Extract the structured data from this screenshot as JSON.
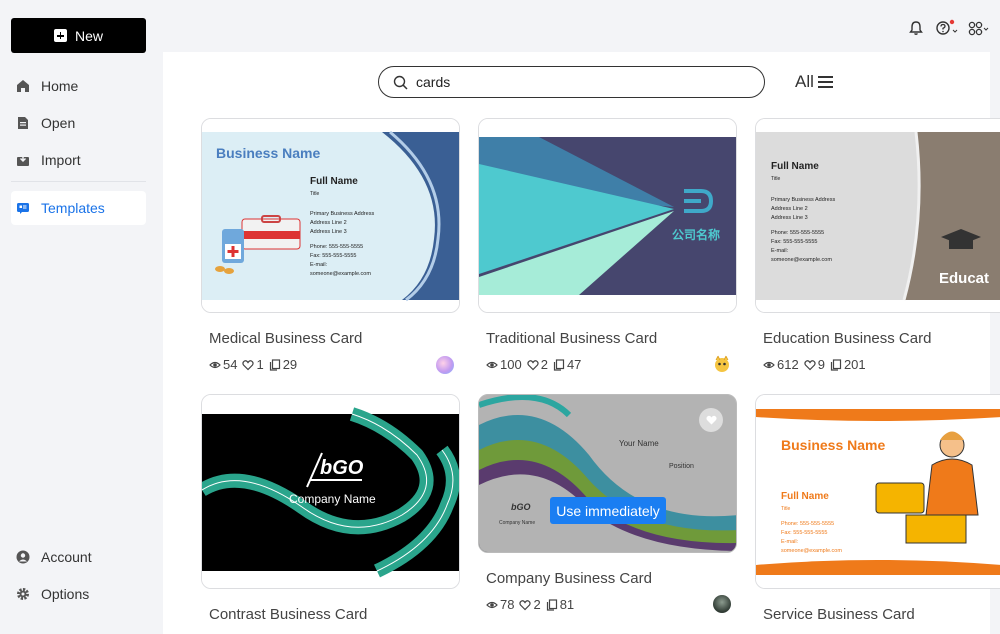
{
  "sidebar": {
    "new_label": "New",
    "items": [
      {
        "label": "Home",
        "icon": "home-icon"
      },
      {
        "label": "Open",
        "icon": "file-icon"
      },
      {
        "label": "Import",
        "icon": "import-icon"
      },
      {
        "label": "Templates",
        "icon": "templates-icon"
      }
    ],
    "bottom_items": [
      {
        "label": "Account",
        "icon": "user-icon"
      },
      {
        "label": "Options",
        "icon": "gear-icon"
      }
    ]
  },
  "search": {
    "value": "cards",
    "placeholder": ""
  },
  "filter": {
    "label": "All"
  },
  "hover_action": {
    "label": "Use immediately"
  },
  "cards": [
    {
      "title": "Medical Business Card",
      "views": "54",
      "likes": "1",
      "copies": "29",
      "thumb": {
        "business_name": "Business Name",
        "full_name": "Full Name",
        "title": "Title",
        "lines": [
          "Primary Business Address",
          "Address Line 2",
          "Address Line 3",
          "",
          "Phone: 555-555-5555",
          "Fax: 555-555-5555",
          "E-mail:",
          "someone@example.com"
        ]
      }
    },
    {
      "title": "Traditional Business Card",
      "views": "100",
      "likes": "2",
      "copies": "47",
      "thumb": {
        "company": "公司名称"
      }
    },
    {
      "title": "Education Business Card",
      "views": "612",
      "likes": "9",
      "copies": "201",
      "thumb": {
        "full_name": "Full Name",
        "title": "Title",
        "lines": [
          "Primary Business Address",
          "Address Line 2",
          "Address Line 3",
          "",
          "Phone: 555-555-5555",
          "Fax: 555-555-5555",
          "E-mail:",
          "someone@example.com"
        ],
        "banner": "Educat"
      }
    },
    {
      "title": "Contrast Business Card",
      "thumb": {
        "logo": "bGO",
        "company": "Company Name"
      }
    },
    {
      "title": "Company Business Card",
      "views": "78",
      "likes": "2",
      "copies": "81",
      "thumb": {
        "your_name": "Your Name",
        "position": "Position",
        "logo": "bGO",
        "company": "Company Name"
      }
    },
    {
      "title": "Service Business Card",
      "thumb": {
        "business_name": "Business Name",
        "full_name": "Full Name",
        "title": "Title",
        "lines": [
          "Phone: 555-555-5555",
          "Fax: 555-555-5555",
          "E-mail:",
          "someone@example.com"
        ]
      }
    }
  ],
  "colors": {
    "accent": "#1a73e8",
    "use_button": "#1a7ef2",
    "notification_dot": "#e53935"
  }
}
